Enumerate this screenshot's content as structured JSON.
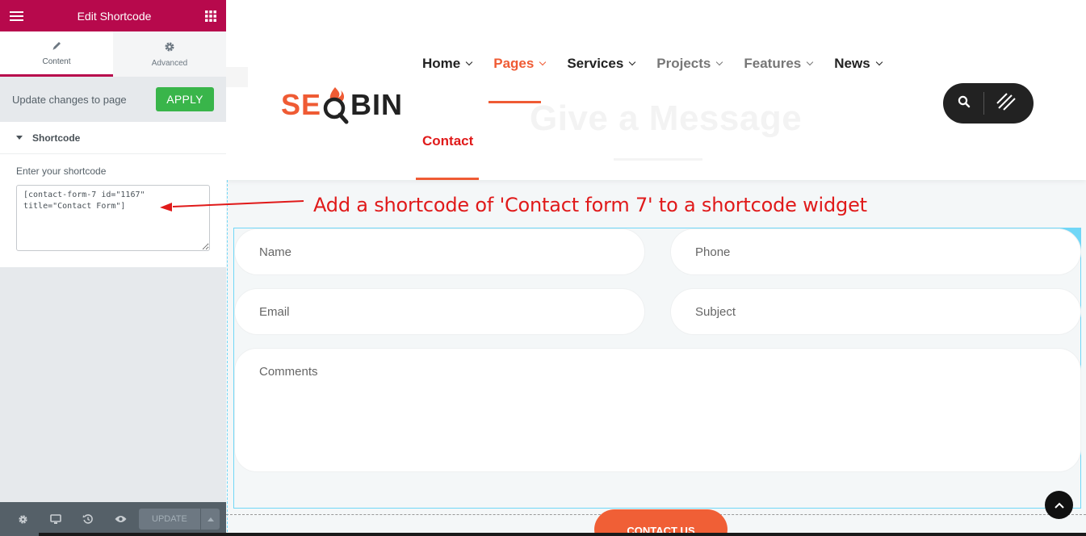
{
  "panel": {
    "header_title": "Edit Shortcode",
    "tabs": [
      {
        "label": "Content",
        "icon": "pencil-icon"
      },
      {
        "label": "Advanced",
        "icon": "gear-icon"
      }
    ],
    "update_notice": "Update changes to page",
    "apply_label": "APPLY",
    "section_title": "Shortcode",
    "shortcode_label": "Enter your shortcode",
    "shortcode_value": "[contact-form-7 id=\"1167\" title=\"Contact Form\"]",
    "footer": {
      "update_label": "UPDATE"
    },
    "accent_color": "#b7094c",
    "apply_color": "#39b54a"
  },
  "site": {
    "logo_seo": "SE",
    "logo_q": "Q",
    "logo_bin": "BIN",
    "nav": [
      {
        "label": "Home",
        "state": "normal"
      },
      {
        "label": "Pages",
        "state": "active"
      },
      {
        "label": "Services",
        "state": "normal"
      },
      {
        "label": "Projects",
        "state": "grey"
      },
      {
        "label": "Features",
        "state": "grey"
      },
      {
        "label": "News",
        "state": "normal"
      }
    ],
    "contact_nav": "Contact",
    "ghost_heading": "Give a Message",
    "brand_color": "#ef5b34"
  },
  "annotation": "Add a shortcode of 'Contact form 7' to a shortcode widget",
  "form": {
    "name_placeholder": "Name",
    "phone_placeholder": "Phone",
    "email_placeholder": "Email",
    "subject_placeholder": "Subject",
    "comments_placeholder": "Comments",
    "submit_label": "CONTACT US"
  }
}
